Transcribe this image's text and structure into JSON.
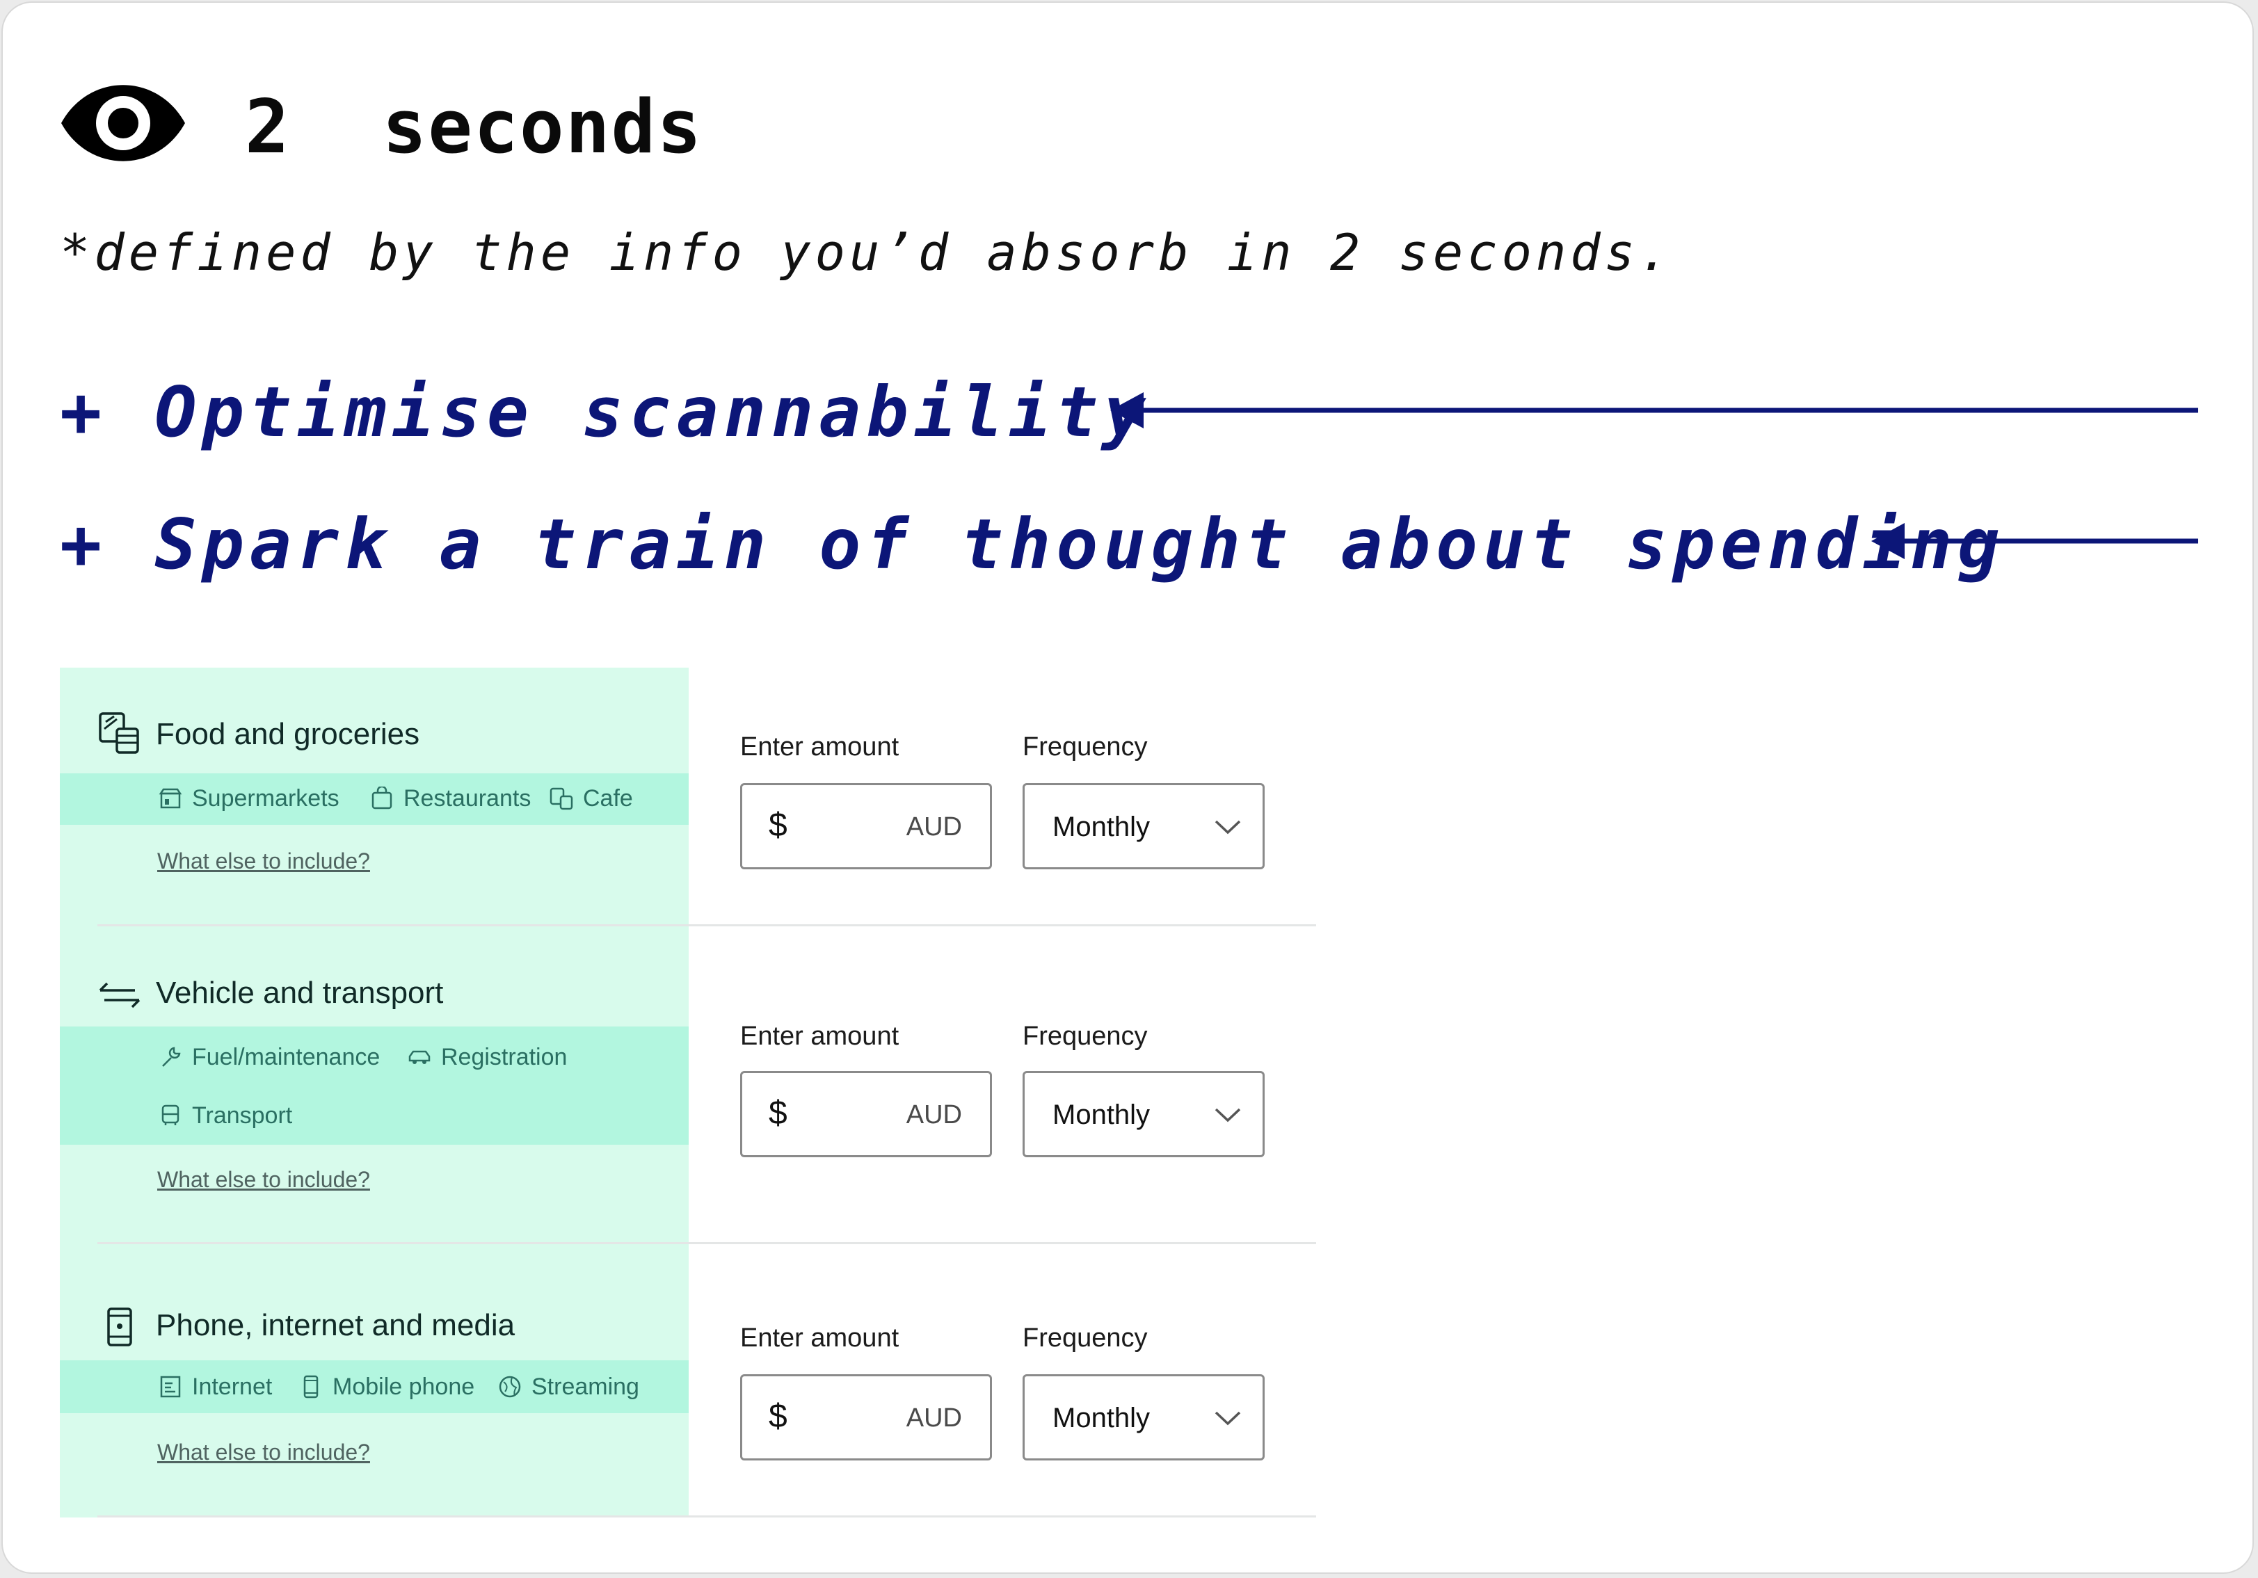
{
  "header": {
    "title": "2  seconds",
    "subtitle": "*defined by the info you’d absorb in 2 seconds.",
    "icon": "eye-icon"
  },
  "bullets": [
    "+ Optimise scannability",
    "+ Spark a train of thought about spending"
  ],
  "colors": {
    "accent": "#0c1678",
    "panel": "#d8fbec",
    "band": "#b2f6df",
    "tag_text": "#2a6f62"
  },
  "categories": [
    {
      "title": "Food and groceries",
      "icon": "food-icon",
      "tags": [
        {
          "icon": "store-icon",
          "label": "Supermarkets"
        },
        {
          "icon": "bag-icon",
          "label": "Restaurants"
        },
        {
          "icon": "cafe-icon",
          "label": "Cafe"
        }
      ],
      "link": "What else to include?",
      "amount_label": "Enter amount",
      "currency": "$",
      "unit": "AUD",
      "frequency_label": "Frequency",
      "frequency": "Monthly"
    },
    {
      "title": "Vehicle and transport",
      "icon": "swap-arrows-icon",
      "tags": [
        {
          "icon": "wrench-icon",
          "label": "Fuel/maintenance"
        },
        {
          "icon": "car-icon",
          "label": "Registration"
        },
        {
          "icon": "bus-icon",
          "label": "Transport"
        }
      ],
      "link": "What else to include?",
      "amount_label": "Enter amount",
      "currency": "$",
      "unit": "AUD",
      "frequency_label": "Frequency",
      "frequency": "Monthly"
    },
    {
      "title": "Phone, internet and media",
      "icon": "phone-icon",
      "tags": [
        {
          "icon": "document-icon",
          "label": "Internet"
        },
        {
          "icon": "mobile-icon",
          "label": "Mobile phone"
        },
        {
          "icon": "globe-icon",
          "label": "Streaming"
        }
      ],
      "link": "What else to include?",
      "amount_label": "Enter amount",
      "currency": "$",
      "unit": "AUD",
      "frequency_label": "Frequency",
      "frequency": "Monthly"
    }
  ]
}
